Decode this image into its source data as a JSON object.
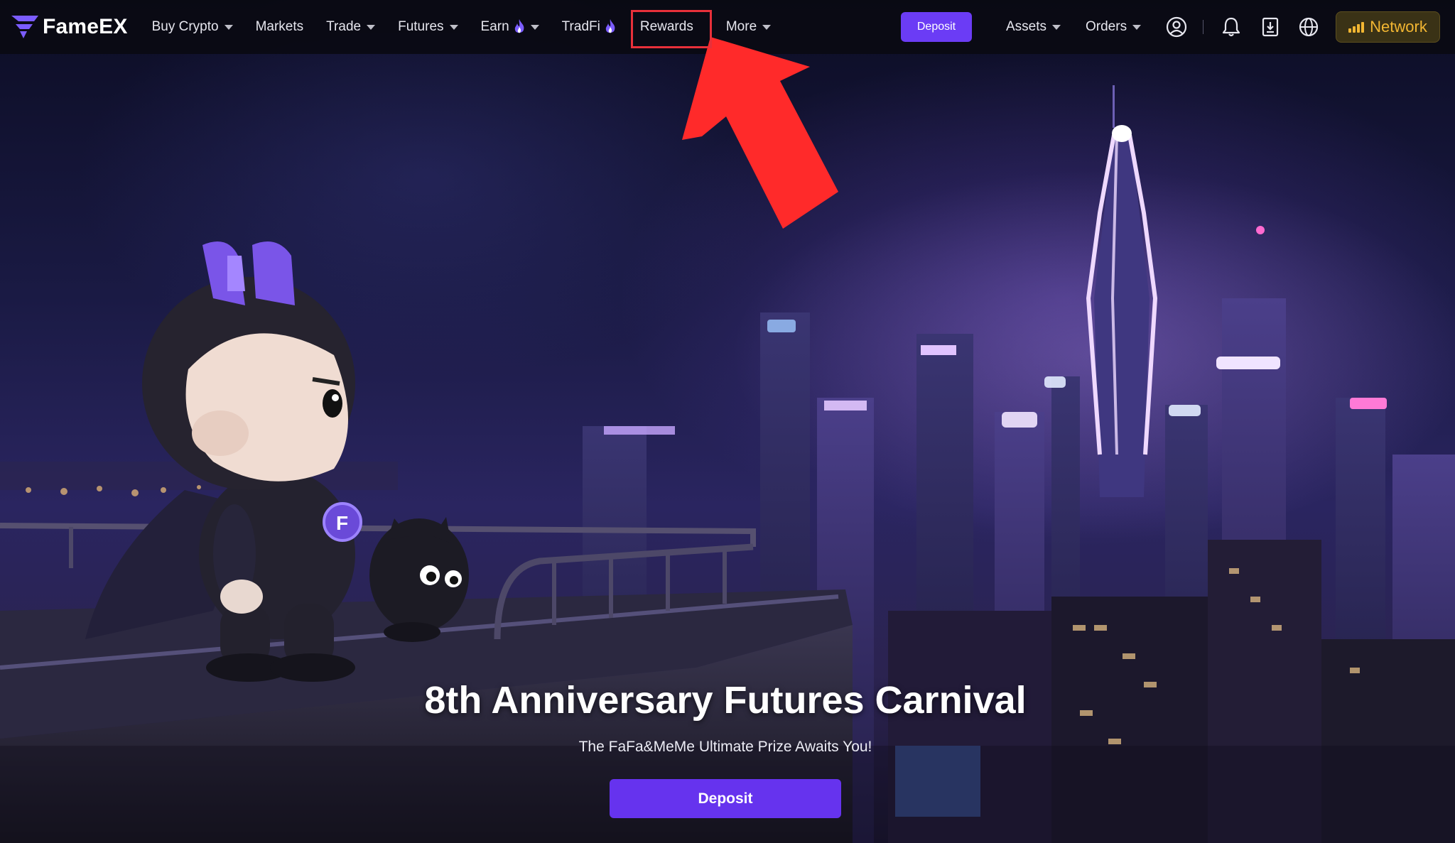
{
  "brand": {
    "name": "FameEX",
    "accent_color": "#6b3cf5",
    "logo_icon": "fameex-logo-icon"
  },
  "nav": {
    "items": [
      {
        "label": "Buy Crypto",
        "has_dropdown": true
      },
      {
        "label": "Markets",
        "has_dropdown": false
      },
      {
        "label": "Trade",
        "has_dropdown": true
      },
      {
        "label": "Futures",
        "has_dropdown": true
      },
      {
        "label": "Earn",
        "has_dropdown": true,
        "icon": "fire-icon"
      },
      {
        "label": "TradFi",
        "has_dropdown": false,
        "icon": "fire-icon"
      },
      {
        "label": "Rewards",
        "has_dropdown": false,
        "highlighted": true
      },
      {
        "label": "More",
        "has_dropdown": true
      }
    ],
    "deposit_label": "Deposit",
    "assets_label": "Assets",
    "orders_label": "Orders",
    "icons": [
      "user-icon",
      "bell-icon",
      "download-icon",
      "globe-icon"
    ],
    "network_label": "Network",
    "network_color": "#f2b632"
  },
  "annotation": {
    "highlight_color": "#e8303a",
    "arrow_color": "#ff2a2a",
    "points_to": "Rewards"
  },
  "hero": {
    "title": "8th Anniversary Futures Carnival",
    "subtitle": "The FaFa&MeMe Ultimate Prize Awaits You!",
    "cta_label": "Deposit"
  }
}
